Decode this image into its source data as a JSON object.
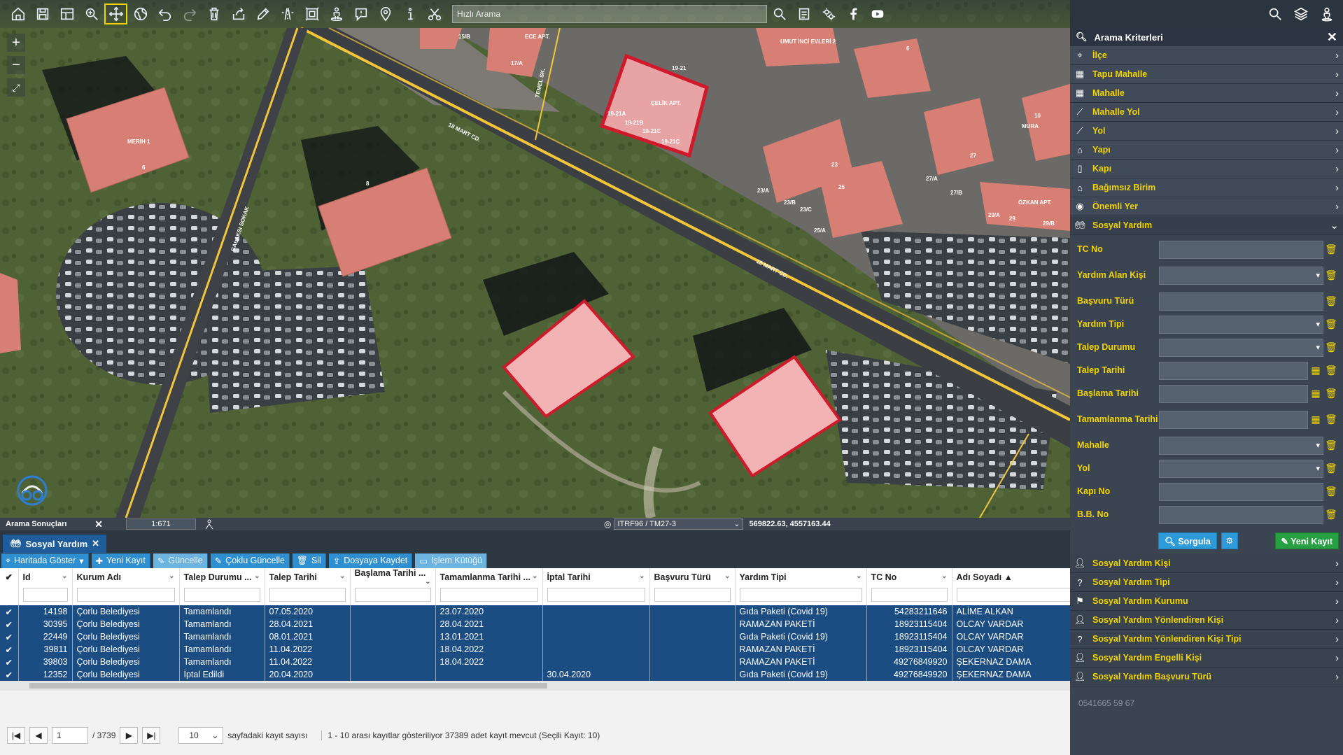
{
  "toolbar": {
    "search_placeholder": "Hızlı Arama"
  },
  "map": {
    "scale": "1:671",
    "crs": "ITRF96 / TM27-3",
    "coordinates": "569822.63, 4557163.44",
    "results_tab": "Arama Sonuçları",
    "labels": {
      "street_18mart_a": "18 MART CD.",
      "street_18mart_b": "18 MART CD.",
      "street_gulsah": "GALAKSI SOKAK",
      "street_temel": "TEMEL SK.",
      "celik_apt": "ÇELİK APT.",
      "merih": "MERİH 1",
      "ozkan_apt": "ÖZKAN APT.",
      "umut": "UMUT İNCİ EVLERİ 2",
      "ece_apt": "ECE APT.",
      "no_19_21": "19-21",
      "no_19_21a": "19-21A",
      "no_19_21b": "19-21B",
      "no_19_21c": "19-21C",
      "no_19_21d": "19-21Ç",
      "no_15b": "15/B",
      "no_17a": "17/A",
      "no_6a": "6",
      "no_6b": "6",
      "no_8": "8",
      "no_23": "23",
      "no_23a": "23/A",
      "no_23b": "23/B",
      "no_23c": "23/C",
      "no_25": "25",
      "no_25a": "25/A",
      "no_27": "27",
      "no_27a": "27/A",
      "no_27b": "27/B",
      "no_29": "29",
      "no_29a": "29/A",
      "no_29b": "29/B",
      "no_10": "10",
      "mura": "MURA"
    }
  },
  "panel": {
    "title": "Arama Kriterleri",
    "criteria": [
      "İlçe",
      "Tapu Mahalle",
      "Mahalle",
      "Mahalle Yol",
      "Yol",
      "Yapı",
      "Kapı",
      "Bağımsız Birim",
      "Önemli Yer"
    ],
    "open_section": "Sosyal Yardım",
    "fields": [
      "TC No",
      "Yardım Alan Kişi",
      "Başvuru Türü",
      "Yardım Tipi",
      "Talep Durumu",
      "Talep Tarihi",
      "Başlama Tarihi",
      "Tamamlanma Tarihi",
      "Mahalle",
      "Yol",
      "Kapı No",
      "B.B. No"
    ],
    "query_button": "Sorgula",
    "new_button": "Yeni Kayıt",
    "related": [
      "Sosyal Yardım Kişi",
      "Sosyal Yardım Tipi",
      "Sosyal Yardım Kurumu",
      "Sosyal Yardım Yönlendiren Kişi",
      "Sosyal Yardım Yönlendiren Kişi Tipi",
      "Sosyal Yardım Engelli Kişi",
      "Sosyal Yardım Başvuru Türü"
    ],
    "ghost_phone": "0541665 59 67"
  },
  "results": {
    "tab": "Sosyal Yardım",
    "actions": [
      "Haritada Göster",
      "Yeni Kayıt",
      "Güncelle",
      "Çoklu Güncelle",
      "Sil",
      "Dosyaya Kaydet",
      "İşlem Kütüğü"
    ],
    "columns": [
      "Id",
      "Kurum Adı",
      "Talep Durumu ...",
      "Talep Tarihi",
      "Başlama Tarihi ...",
      "Tamamlanma Tarihi ...",
      "İptal Tarihi",
      "Başvuru Türü",
      "Yardım Tipi",
      "TC No",
      "Adı Soyadı"
    ],
    "rows": [
      [
        "14198",
        "Çorlu Belediyesi",
        "Tamamlandı",
        "07.05.2020",
        "",
        "23.07.2020",
        "",
        "",
        "Gıda Paketi (Covid 19)",
        "54283211646",
        "ALİME ALKAN"
      ],
      [
        "30395",
        "Çorlu Belediyesi",
        "Tamamlandı",
        "28.04.2021",
        "",
        "28.04.2021",
        "",
        "",
        "RAMAZAN PAKETİ",
        "18923115404",
        "OLCAY VARDAR"
      ],
      [
        "22449",
        "Çorlu Belediyesi",
        "Tamamlandı",
        "08.01.2021",
        "",
        "13.01.2021",
        "",
        "",
        "Gıda Paketi (Covid 19)",
        "18923115404",
        "OLCAY VARDAR"
      ],
      [
        "39811",
        "Çorlu Belediyesi",
        "Tamamlandı",
        "11.04.2022",
        "",
        "18.04.2022",
        "",
        "",
        "RAMAZAN PAKETİ",
        "18923115404",
        "OLCAY VARDAR"
      ],
      [
        "39803",
        "Çorlu Belediyesi",
        "Tamamlandı",
        "11.04.2022",
        "",
        "18.04.2022",
        "",
        "",
        "RAMAZAN PAKETİ",
        "49276849920",
        "ŞEKERNAZ DAMA"
      ],
      [
        "12352",
        "Çorlu Belediyesi",
        "İptal Edildi",
        "20.04.2020",
        "",
        "",
        "30.04.2020",
        "",
        "Gıda Paketi (Covid 19)",
        "49276849920",
        "ŞEKERNAZ DAMA"
      ]
    ],
    "pager": {
      "page": "1",
      "total_pages": "/ 3739",
      "page_size": "10",
      "page_size_label": "sayfadaki kayıt sayısı",
      "info": "1 - 10 arası kayıtlar gösteriliyor 37389 adet kayıt mevcut (Seçili Kayıt: 10)"
    }
  },
  "colors": {
    "accent_yellow": "#f1d400",
    "selected_row": "#1b4d83",
    "action_blue": "#2f8fd0",
    "new_green": "#26a043",
    "building_fill": "#e8a3a4",
    "selected_outline": "#d01a2c"
  }
}
